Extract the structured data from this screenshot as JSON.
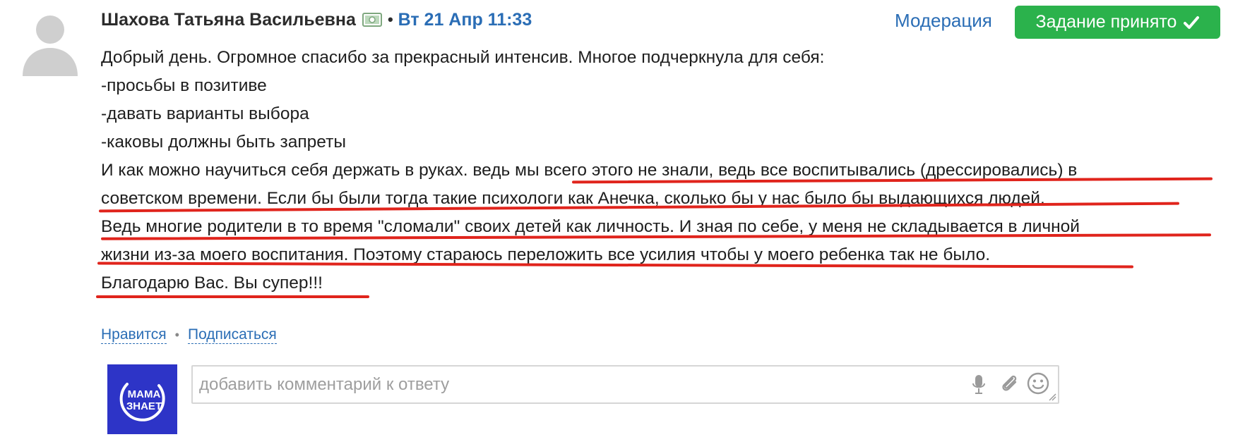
{
  "post": {
    "author_name": "Шахова Татьяна Васильевна",
    "separator": "•",
    "datetime": "Вт 21 Апр 11:33",
    "moderation_label": "Модерация",
    "status_button_label": "Задание принято"
  },
  "body": {
    "lines": [
      "Добрый день. Огромное спасибо за прекрасный интенсив. Многое подчеркнула для себя:",
      "-просьбы в позитиве",
      "-давать варианты выбора",
      "-каковы должны быть запреты",
      "И как можно научиться себя держать в руках. ведь мы всего этого не знали, ведь все воспитывались (дрессировались) в",
      "советском времени. Если бы были тогда такие психологи как Анечка, сколько бы у нас было бы выдающихся людей.",
      "Ведь многие родители в то время \"сломали\" своих детей как личность. И зная по себе, у меня не складывается в личной",
      "жизни из-за моего воспитания. Поэтому стараюсь переложить все усилия чтобы у моего ребенка так не было.",
      "Благодарю Вас. Вы супер!!!"
    ]
  },
  "actions": {
    "like_label": "Нравится",
    "dot": "•",
    "subscribe_label": "Подписаться"
  },
  "comment": {
    "placeholder": "добавить комментарий к ответу"
  },
  "logo": {
    "text_line1": "МАМА",
    "text_line2": "ЗНАЕТ"
  },
  "colors": {
    "link_blue": "#2a6db5",
    "accepted_green": "#2bb24c",
    "underline_red": "#e0241c",
    "logo_bg": "#2d34c7"
  },
  "icons": {
    "avatar": "default-user-avatar",
    "money": "money-bill-icon",
    "check": "check-icon",
    "microphone": "microphone-icon",
    "attach": "paperclip-icon",
    "emoji": "smiley-icon"
  }
}
